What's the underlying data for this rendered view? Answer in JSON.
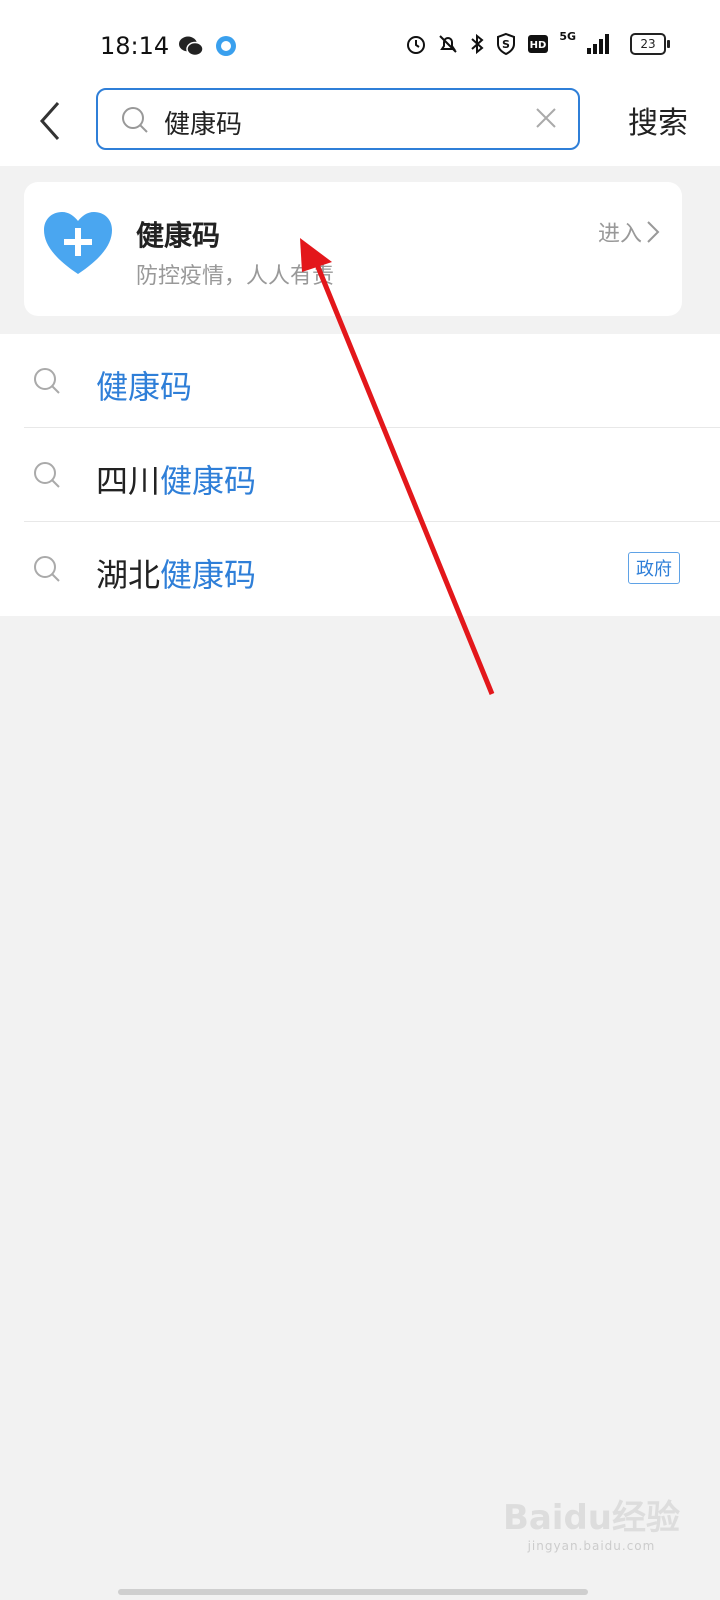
{
  "status_bar": {
    "time": "18:14",
    "battery": "23",
    "network": "5G"
  },
  "header": {
    "query": "健康码",
    "search_button": "搜索"
  },
  "top_result": {
    "title": "健康码",
    "subtitle": "防控疫情，人人有责",
    "enter_label": "进入"
  },
  "suggestions": [
    {
      "prefix": "",
      "highlight": "健康码",
      "tag": ""
    },
    {
      "prefix": "四川",
      "highlight": "健康码",
      "tag": ""
    },
    {
      "prefix": "湖北",
      "highlight": "健康码",
      "tag": "政府"
    }
  ],
  "watermark": {
    "brand": "Baidu经验",
    "url": "jingyan.baidu.com"
  },
  "colors": {
    "accent": "#2f7fd8",
    "heart": "#4aa6f0",
    "annotation_arrow": "#e3171b"
  }
}
